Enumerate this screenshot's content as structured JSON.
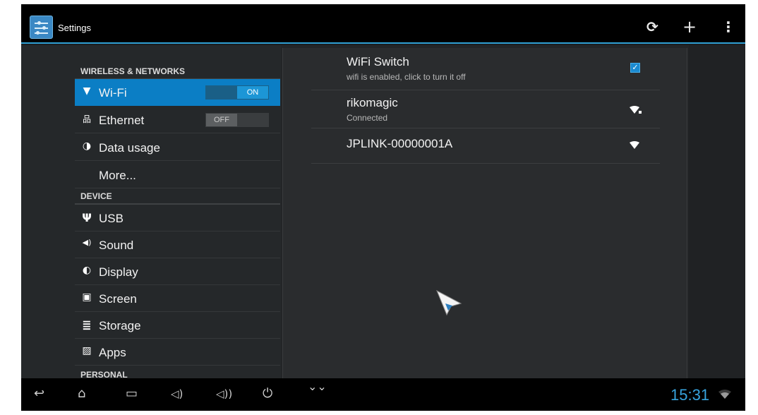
{
  "app": {
    "title": "Settings",
    "icon": "settings-app-icon"
  },
  "action_bar": {
    "actions": [
      {
        "name": "sync-icon",
        "glyph": "⟳"
      },
      {
        "name": "add-icon",
        "glyph": "+"
      },
      {
        "name": "overflow-menu-icon",
        "glyph": "⋮"
      }
    ]
  },
  "sidebar": {
    "sections": [
      {
        "header": "WIRELESS & NETWORKS"
      },
      {
        "header": "DEVICE"
      },
      {
        "header": "PERSONAL"
      }
    ],
    "items": [
      {
        "label": "Wi-Fi",
        "icon": "wifi-icon",
        "glyph": "▼",
        "selected": true,
        "toggle": "ON"
      },
      {
        "label": "Ethernet",
        "icon": "ethernet-icon",
        "glyph": "品",
        "toggle": "OFF"
      },
      {
        "label": "Data usage",
        "icon": "data-usage-icon",
        "glyph": "◑"
      },
      {
        "label": "More...",
        "icon": ""
      },
      {
        "label": "USB",
        "icon": "usb-icon",
        "glyph": "Ψ"
      },
      {
        "label": "Sound",
        "icon": "sound-icon",
        "glyph": "◀)"
      },
      {
        "label": "Display",
        "icon": "display-icon",
        "glyph": "◐"
      },
      {
        "label": "Screen",
        "icon": "screen-icon",
        "glyph": "▣"
      },
      {
        "label": "Storage",
        "icon": "storage-icon",
        "glyph": "≣"
      },
      {
        "label": "Apps",
        "icon": "apps-icon",
        "glyph": "▨"
      }
    ]
  },
  "wifi_panel": {
    "switch": {
      "title": "WiFi Switch",
      "subtitle": "wifi is enabled, click to turn it off",
      "checked": true,
      "check_glyph": "✓"
    },
    "networks": [
      {
        "ssid": "rikomagic",
        "status": "Connected",
        "icon": "wifi-secured-icon"
      },
      {
        "ssid": "JPLINK-00000001A",
        "status": "",
        "icon": "wifi-signal-icon"
      }
    ]
  },
  "nav_bar": {
    "buttons": [
      {
        "name": "back-button",
        "glyph": "↩"
      },
      {
        "name": "home-button",
        "glyph": "⌂"
      },
      {
        "name": "recent-apps-button",
        "glyph": "▭"
      },
      {
        "name": "volume-down-button",
        "glyph": "◁)"
      },
      {
        "name": "volume-up-button",
        "glyph": "◁))"
      },
      {
        "name": "power-button",
        "glyph": "⏻"
      },
      {
        "name": "expand-button",
        "glyph": "⌄⌄"
      }
    ],
    "clock": "15:31"
  },
  "colors": {
    "accent": "#0b7ec5",
    "clock": "#37a3dd",
    "background": "#232527"
  }
}
